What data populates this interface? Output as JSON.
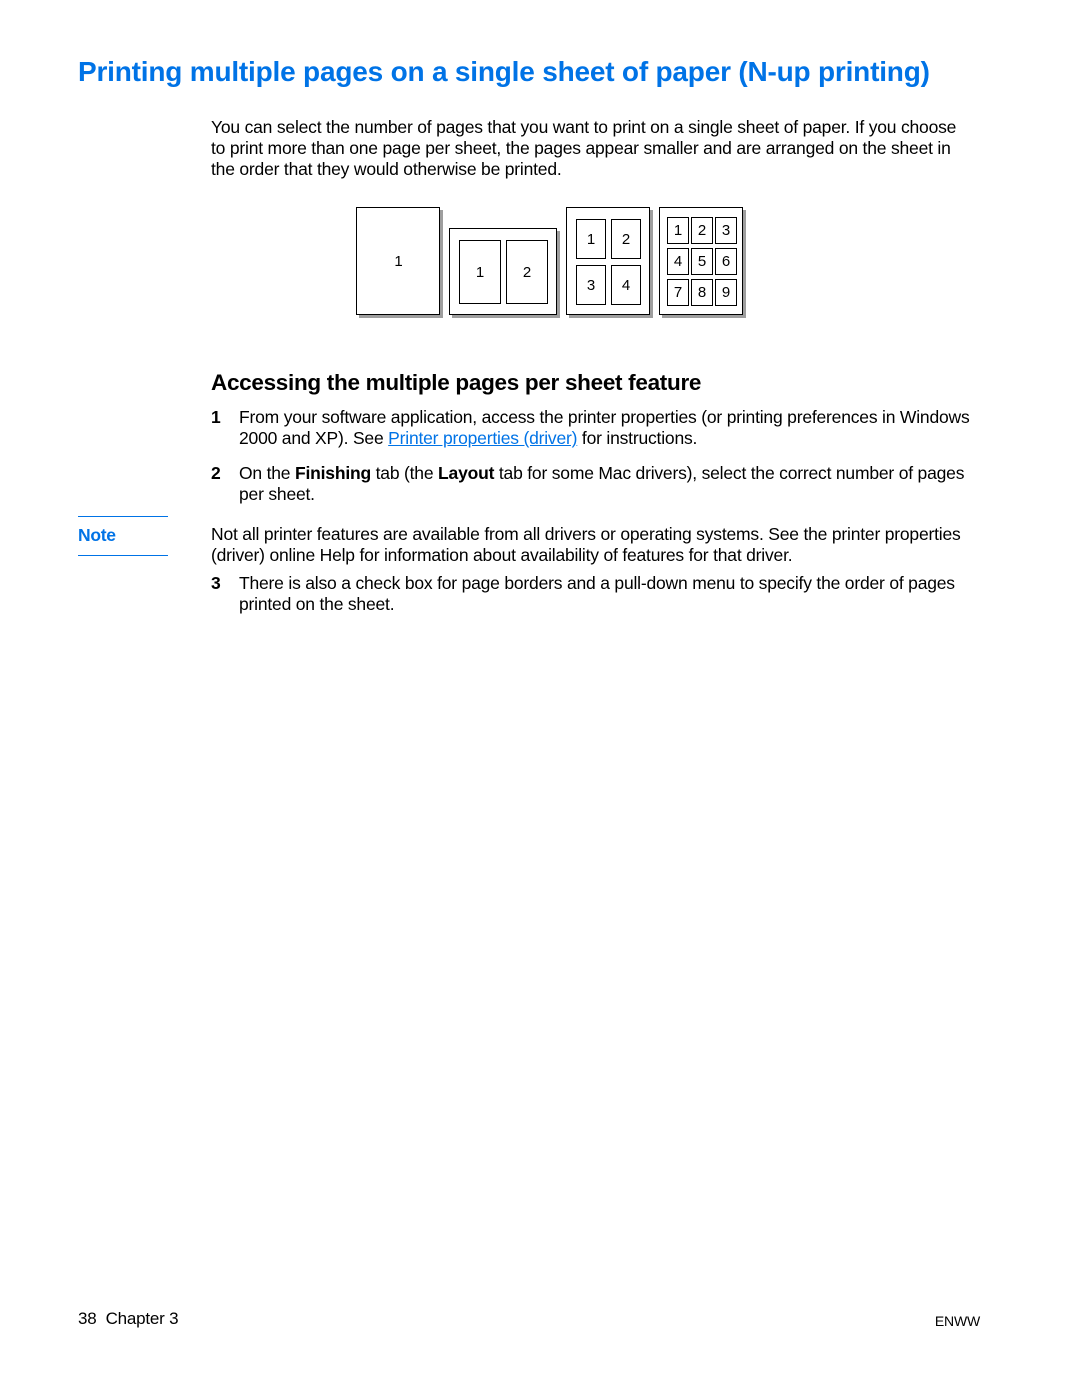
{
  "title": "Printing multiple pages on a single sheet of paper (N-up printing)",
  "intro": "You can select the number of pages that you want to print on a single sheet of paper. If you choose to print more than one page per sheet, the pages appear smaller and are arranged on the sheet in the order that they would otherwise be printed.",
  "subtitle": "Accessing the multiple pages per sheet feature",
  "steps": {
    "s1_num": "1",
    "s1a": "From your software application, access the printer properties (or printing preferences in Windows 2000 and XP). See ",
    "s1_link": "Printer properties (driver)",
    "s1b": " for instructions.",
    "s2_num": "2",
    "s2a": "On the ",
    "s2_bold1": "Finishing",
    "s2b": " tab (the ",
    "s2_bold2": "Layout",
    "s2c": " tab for some Mac drivers), select the correct number of pages per sheet."
  },
  "note_label": "Note",
  "note_text": "Not all printer features are available from all drivers or operating systems. See the printer properties (driver) online Help for information about availability of features for that driver.",
  "step3": {
    "num": "3",
    "txt": "There is also a check box for page borders and a pull-down menu to specify the order of pages printed on the sheet."
  },
  "footer": {
    "page": "38",
    "chapter": "Chapter 3",
    "lang": "ENWW"
  },
  "diagram": {
    "d1": [
      "1"
    ],
    "d2": [
      "1",
      "2"
    ],
    "d4": [
      "1",
      "2",
      "3",
      "4"
    ],
    "d9": [
      "1",
      "2",
      "3",
      "4",
      "5",
      "6",
      "7",
      "8",
      "9"
    ]
  }
}
